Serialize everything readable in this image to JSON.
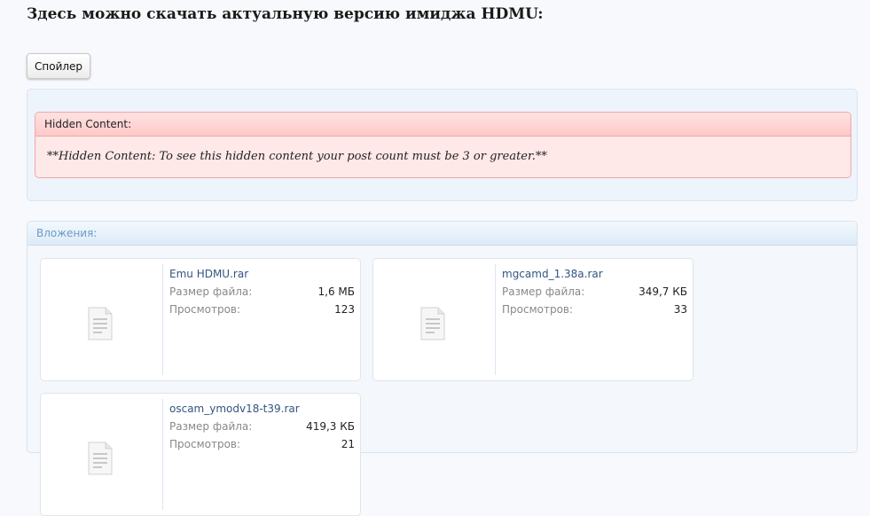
{
  "heading": "Здесь можно скачать актуальную версию имиджа HDMU:",
  "spoiler_button": "Спойлер",
  "hidden": {
    "header": "Hidden Content:",
    "message": "**Hidden Content: To see this hidden content your post count must be 3 or greater.**"
  },
  "attachments": {
    "title": "Вложения:",
    "size_label": "Размер файла:",
    "views_label": "Просмотров:",
    "items": [
      {
        "name": "Emu HDMU.rar",
        "size": "1,6 МБ",
        "views": "123",
        "icon": "document-icon"
      },
      {
        "name": "mgcamd_1.38a.rar",
        "size": "349,7 КБ",
        "views": "33",
        "icon": "document-icon"
      },
      {
        "name": "oscam_ymodv18-t39.rar",
        "size": "419,3 КБ",
        "views": "21",
        "icon": "document-icon"
      }
    ]
  },
  "colors": {
    "hidden_border": "#f0a7a7",
    "hidden_bg": "#ffe8e8",
    "attach_title": "#6b9cc7",
    "link": "#335580"
  }
}
